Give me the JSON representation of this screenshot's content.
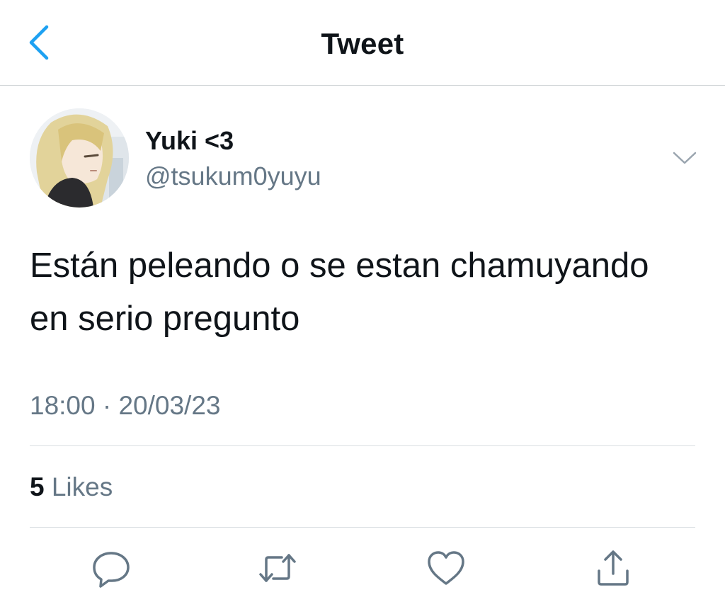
{
  "header": {
    "title": "Tweet",
    "back_icon": "chevron-left-icon"
  },
  "author": {
    "name": "Yuki <3",
    "handle": "@tsukum0yuyu",
    "avatar": "avatar-image",
    "more_icon": "chevron-down-icon"
  },
  "tweet": {
    "text": "Están peleando o se estan chamuyando en serio pregunto",
    "timestamp": "18:00 · 20/03/23"
  },
  "stats": {
    "likes_count": "5",
    "likes_label": "Likes"
  },
  "actions": [
    {
      "icon": "reply-icon"
    },
    {
      "icon": "retweet-icon"
    },
    {
      "icon": "like-icon"
    },
    {
      "icon": "share-icon"
    }
  ],
  "colors": {
    "accent": "#1da1f2",
    "text_primary": "#0f1419",
    "text_secondary": "#657786",
    "divider": "#d8dde1"
  }
}
